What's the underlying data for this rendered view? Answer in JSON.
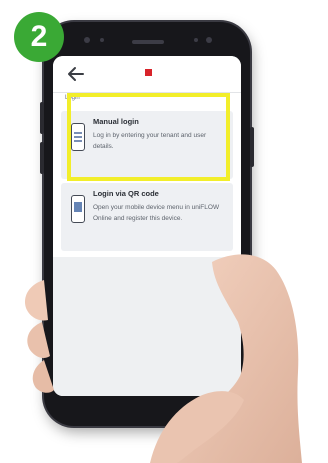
{
  "step": {
    "number": "2",
    "color": "#3aa935"
  },
  "highlight": {
    "color": "#f2ee2a"
  },
  "app": {
    "brand_color": "#d8232a",
    "back_icon": "arrow-left-icon",
    "section_title": "Login",
    "options": [
      {
        "title": "Manual login",
        "description": "Log in by entering your tenant and user details.",
        "icon": "phone-form-icon",
        "highlighted": true
      },
      {
        "title": "Login via QR code",
        "description": "Open your mobile device menu in uniFLOW Online and register this device.",
        "icon": "phone-qr-icon",
        "highlighted": false
      }
    ]
  }
}
